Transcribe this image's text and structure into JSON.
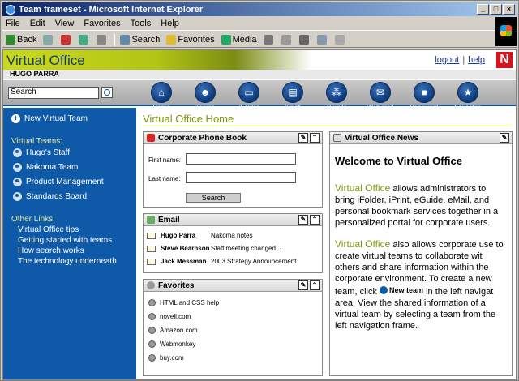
{
  "window": {
    "title": "Team frameset - Microsoft Internet Explorer",
    "controls": [
      "_",
      "□",
      "×"
    ]
  },
  "menu": [
    "File",
    "Edit",
    "View",
    "Favorites",
    "Tools",
    "Help"
  ],
  "toolbar": {
    "back": "Back",
    "search": "Search",
    "favorites": "Favorites",
    "media": "Media"
  },
  "banner": {
    "brand": "Virtual Office",
    "logout": "logout",
    "sep": "|",
    "help": "help",
    "logo": "N",
    "user": "HUGO PARRA"
  },
  "search": {
    "value": "Search"
  },
  "nav": [
    {
      "label": "Home",
      "icon": "home-icon"
    },
    {
      "label": "Teams",
      "icon": "teams-icon"
    },
    {
      "label": "iFolder",
      "icon": "ifolder-icon"
    },
    {
      "label": "iPrint",
      "icon": "iprint-icon"
    },
    {
      "label": "eGuide",
      "icon": "eguide-icon"
    },
    {
      "label": "Web mail",
      "icon": "webmail-icon"
    },
    {
      "label": "Password",
      "icon": "password-icon"
    },
    {
      "label": "Favorites",
      "icon": "favorites-star-icon"
    }
  ],
  "sidebar": {
    "new_team": "New Virtual Team",
    "teams_heading": "Virtual Teams:",
    "teams": [
      "Hugo's Staff",
      "Nakoma Team",
      "Product Management",
      "Standards Board"
    ],
    "other_heading": "Other Links:",
    "links": [
      "Virtual Office tips",
      "Getting started with teams",
      "How search works",
      "The technology underneath"
    ]
  },
  "main": {
    "title": "Virtual Office Home",
    "phonebook": {
      "title": "Corporate Phone Book",
      "first": "First name:",
      "last": "Last name:",
      "button": "Search"
    },
    "email": {
      "title": "Email",
      "rows": [
        {
          "from": "Hugo Parra",
          "subject": "Nakoma notes"
        },
        {
          "from": "Steve Bearnson",
          "subject": "Staff meeting changed..."
        },
        {
          "from": "Jack Messman",
          "subject": "2003 Strategy Announcement"
        }
      ]
    },
    "favorites": {
      "title": "Favorites",
      "items": [
        "HTML and CSS help",
        "novell.com",
        "Amazon.com",
        "Webmonkey",
        "buy.com"
      ]
    },
    "news": {
      "title": "Virtual Office News",
      "heading": "Welcome to Virtual Office",
      "brand": "Virtual Office",
      "p1": " allows administrators to bring iFolder, iPrint, eGuide, eMail, and personal bookmark services together in a personalized portal for corporate users.",
      "p2a": " also allows corporate use to create virtual teams to collaborate wit others and share information within the corporate environment. To create a new team, click ",
      "new_team": "New team",
      "p2b": " in the left navigat area. View the shared information of a virtual team by selecting a team from the left navigation frame."
    }
  }
}
